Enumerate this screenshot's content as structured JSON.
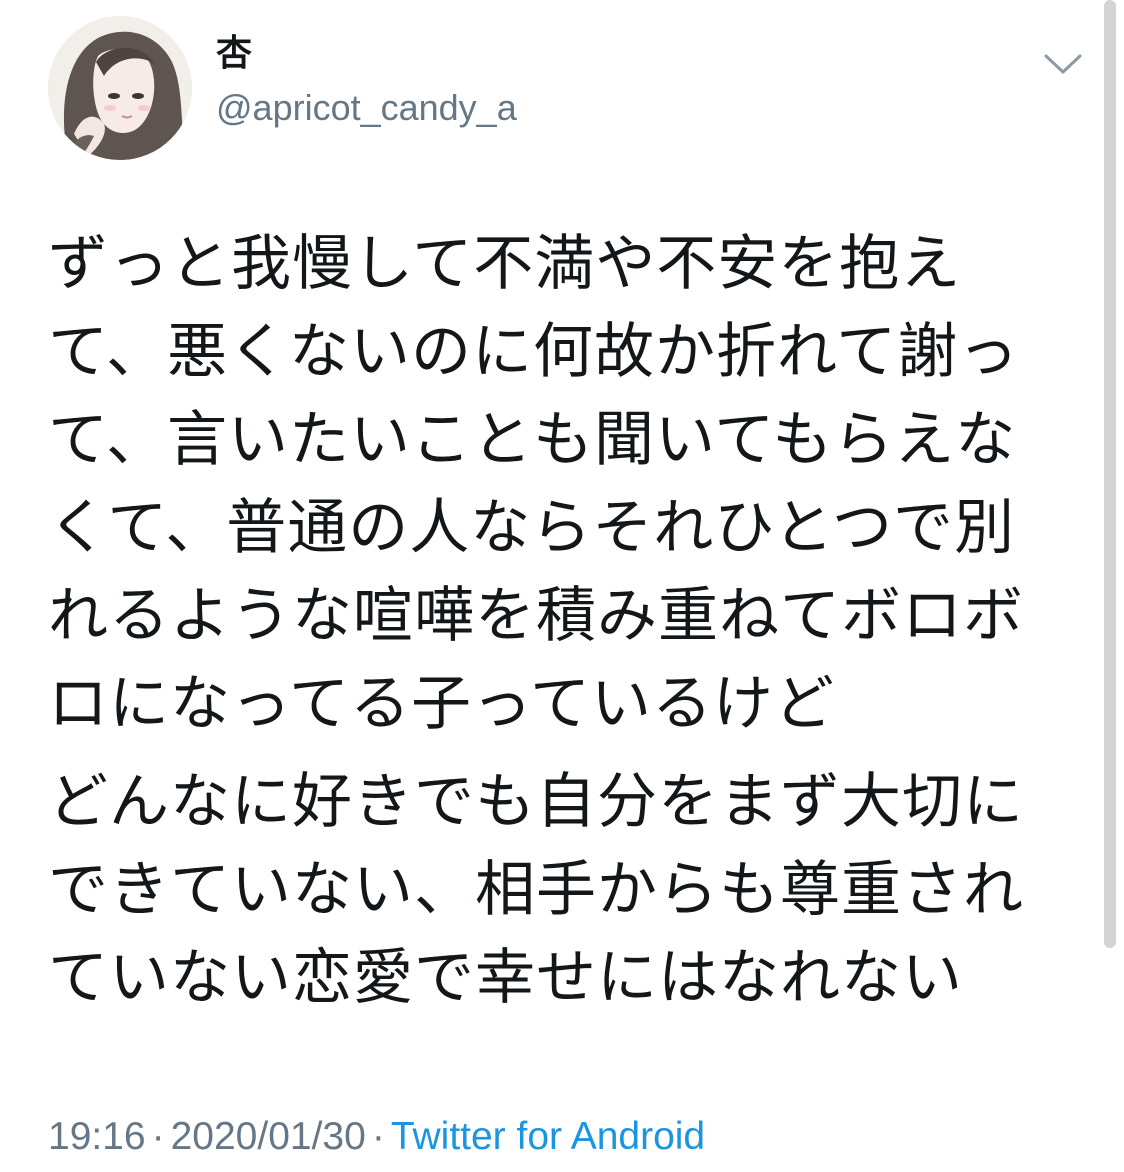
{
  "user": {
    "display_name": "杏",
    "handle": "@apricot_candy_a"
  },
  "tweet": {
    "paragraphs": [
      "ずっと我慢して不満や不安を抱えて、悪くないのに何故か折れて謝って、言いたいことも聞いてもらえなくて、普通の人ならそれひとつで別れるような喧嘩を積み重ねてボロボロになってる子っているけど",
      "どんなに好きでも自分をまず大切にできていない、相手からも尊重されていない恋愛で幸せにはなれない"
    ]
  },
  "meta": {
    "time": "19:16",
    "separator": "·",
    "date": "2020/01/30",
    "source": "Twitter for Android"
  },
  "icons": {
    "avatar": "avatar-illustration",
    "menu": "chevron-down-icon"
  },
  "colors": {
    "text": "#14171a",
    "secondary": "#657786",
    "link": "#1b95e0"
  }
}
